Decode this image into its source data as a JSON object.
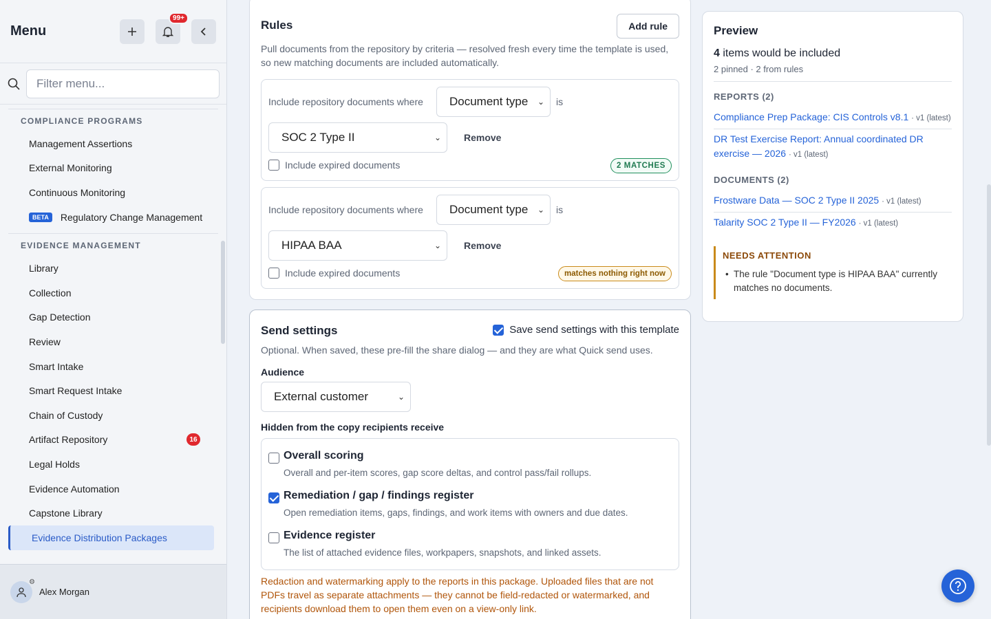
{
  "sidebar": {
    "title": "Menu",
    "notif_count": "99+",
    "filter_placeholder": "Filter menu...",
    "sections": [
      {
        "title": "COMPLIANCE PROGRAMS",
        "items": [
          {
            "label": "Management Assertions"
          },
          {
            "label": "External Monitoring"
          },
          {
            "label": "Continuous Monitoring"
          },
          {
            "label": "Regulatory Change Management",
            "badge": "BETA"
          }
        ]
      },
      {
        "title": "EVIDENCE MANAGEMENT",
        "items": [
          {
            "label": "Library"
          },
          {
            "label": "Collection"
          },
          {
            "label": "Gap Detection"
          },
          {
            "label": "Review"
          },
          {
            "label": "Smart Intake"
          },
          {
            "label": "Smart Request Intake"
          },
          {
            "label": "Chain of Custody"
          },
          {
            "label": "Artifact Repository",
            "count": "16"
          },
          {
            "label": "Legal Holds"
          },
          {
            "label": "Evidence Automation"
          },
          {
            "label": "Capstone Library"
          },
          {
            "label": "Evidence Distribution Packages",
            "active": true
          }
        ]
      }
    ],
    "user_name": "Alex Morgan"
  },
  "rules": {
    "title": "Rules",
    "add_rule": "Add rule",
    "description": "Pull documents from the repository by criteria — resolved fresh every time the template is used, so new matching documents are included automatically.",
    "items": [
      {
        "label": "Include repository documents where",
        "field": "Document type",
        "operator": "is",
        "value": "SOC 2 Type II",
        "remove": "Remove",
        "expired_label": "Include expired documents",
        "status": "2 MATCHES"
      },
      {
        "label": "Include repository documents where",
        "field": "Document type",
        "operator": "is",
        "value": "HIPAA BAA",
        "remove": "Remove",
        "expired_label": "Include expired documents",
        "status": "matches nothing right now"
      }
    ]
  },
  "send": {
    "title": "Send settings",
    "save_label": "Save send settings with this template",
    "save_checked": true,
    "description": "Optional. When saved, these pre-fill the share dialog — and they are what Quick send uses.",
    "audience_label": "Audience",
    "audience_value": "External customer",
    "hidden_label": "Hidden from the copy recipients receive",
    "hidden_items": [
      {
        "title": "Overall scoring",
        "desc": "Overall and per-item scores, gap score deltas, and control pass/fail rollups.",
        "checked": false
      },
      {
        "title": "Remediation / gap / findings register",
        "desc": "Open remediation items, gaps, findings, and work items with owners and due dates.",
        "checked": true
      },
      {
        "title": "Evidence register",
        "desc": "The list of attached evidence files, workpapers, snapshots, and linked assets.",
        "checked": false
      }
    ],
    "warning": "Redaction and watermarking apply to the reports in this package. Uploaded files that are not PDFs travel as separate attachments — they cannot be field-redacted or watermarked, and recipients download them to open them even on a view-only link."
  },
  "preview": {
    "title": "Preview",
    "count": "4",
    "count_suffix": "items would be included",
    "sub": "2 pinned · 2 from rules",
    "reports_title": "REPORTS (2)",
    "reports": [
      {
        "title": "Compliance Prep Package: CIS Controls v8.1",
        "ver": "· v1 (latest)"
      },
      {
        "title": "DR Test Exercise Report: Annual coordinated DR exercise — 2026",
        "ver": "· v1 (latest)"
      }
    ],
    "documents_title": "DOCUMENTS (2)",
    "documents": [
      {
        "title": "Frostware Data — SOC 2 Type II 2025",
        "ver": "· v1 (latest)"
      },
      {
        "title": "Talarity SOC 2 Type II — FY2026",
        "ver": "· v1 (latest)"
      }
    ],
    "attention_title": "NEEDS ATTENTION",
    "attention_text": "The rule \"Document type is HIPAA BAA\" currently matches no documents."
  },
  "colors": {
    "accent": "#2563d8",
    "danger": "#e0282e",
    "warning": "#b0550a",
    "success": "#1f7a50"
  }
}
